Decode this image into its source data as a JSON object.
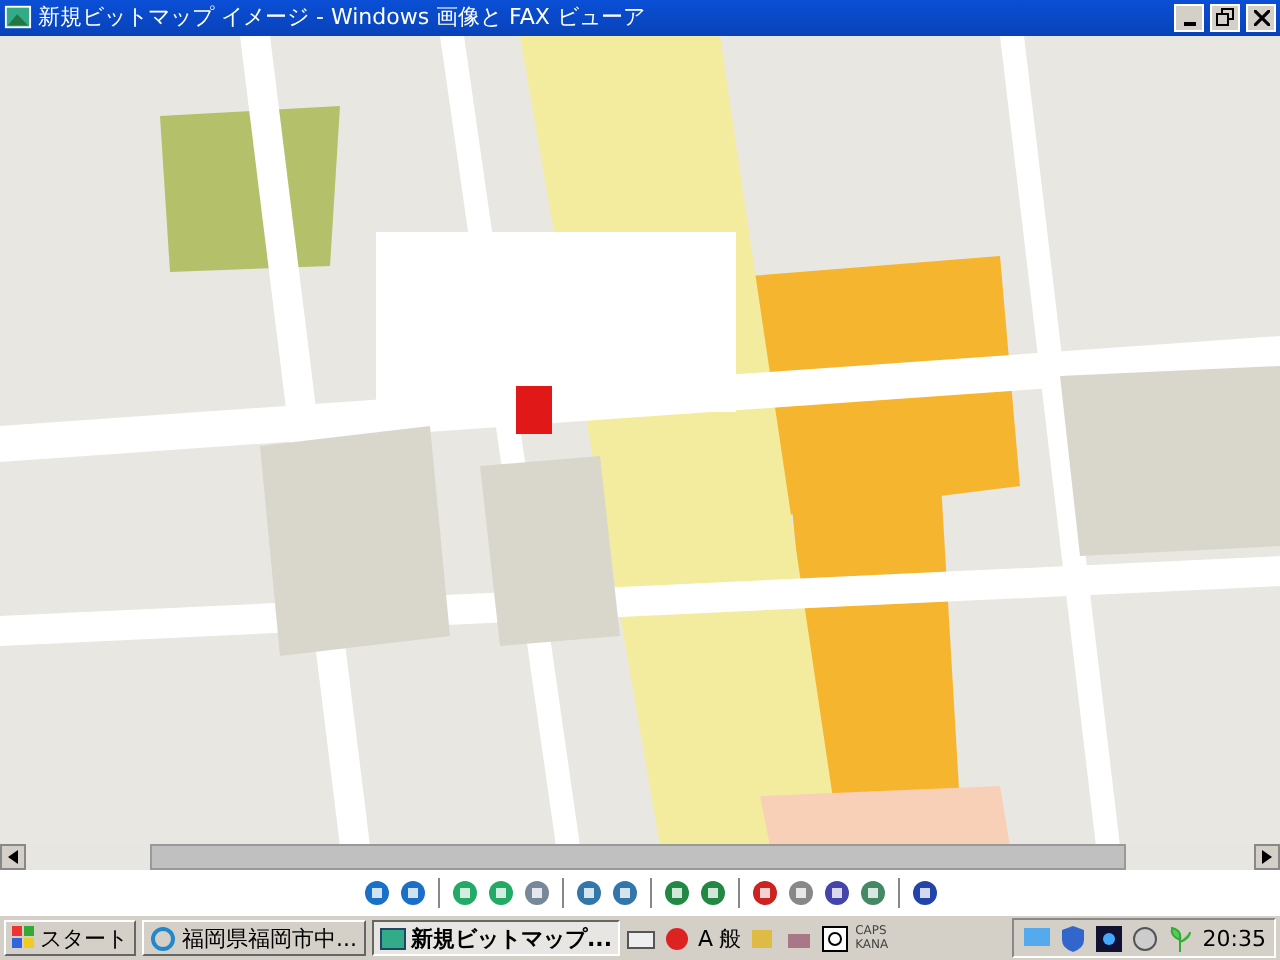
{
  "window": {
    "title": "新規ビットマップ イメージ - Windows 画像と FAX ビューア"
  },
  "taskbar": {
    "start": "スタート",
    "tasks": [
      {
        "label": "福岡県福岡市中...",
        "kind": "browser",
        "selected": false
      },
      {
        "label": "新規ビットマップ...",
        "kind": "viewer",
        "selected": true
      }
    ],
    "ime": [
      "A",
      "般"
    ],
    "keys": [
      "CAPS",
      "KANA"
    ],
    "clock": "20:35"
  }
}
